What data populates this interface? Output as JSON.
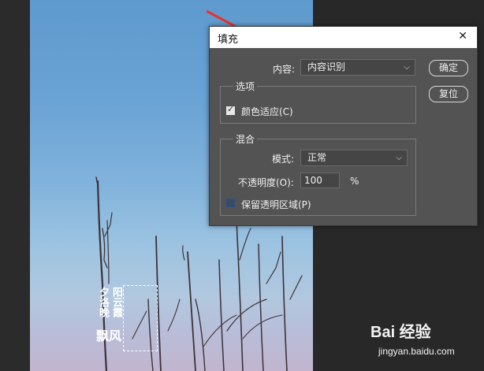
{
  "dialog": {
    "title": "填充",
    "content_label": "内容:",
    "content_value": "内容识别",
    "ok_label": "确定",
    "reset_label": "复位",
    "options_group": "选项",
    "color_adapt_label": "颜色适应(C)",
    "color_adapt_checked": true,
    "blend_group": "混合",
    "mode_label": "模式:",
    "mode_value": "正常",
    "opacity_label": "不透明度(O):",
    "opacity_value": "100",
    "opacity_unit": "%",
    "preserve_label": "保留透明区域(P)",
    "preserve_checked": false
  },
  "canvas_text": {
    "col1": "夕洛晚",
    "col2": "阳云霞",
    "bottom": "飘风"
  },
  "watermark": {
    "logo": "Bai 经验",
    "url": "jingyan.baidu.com"
  },
  "colors": {
    "dialog_bg": "#535353",
    "arrow": "#e8322c"
  }
}
